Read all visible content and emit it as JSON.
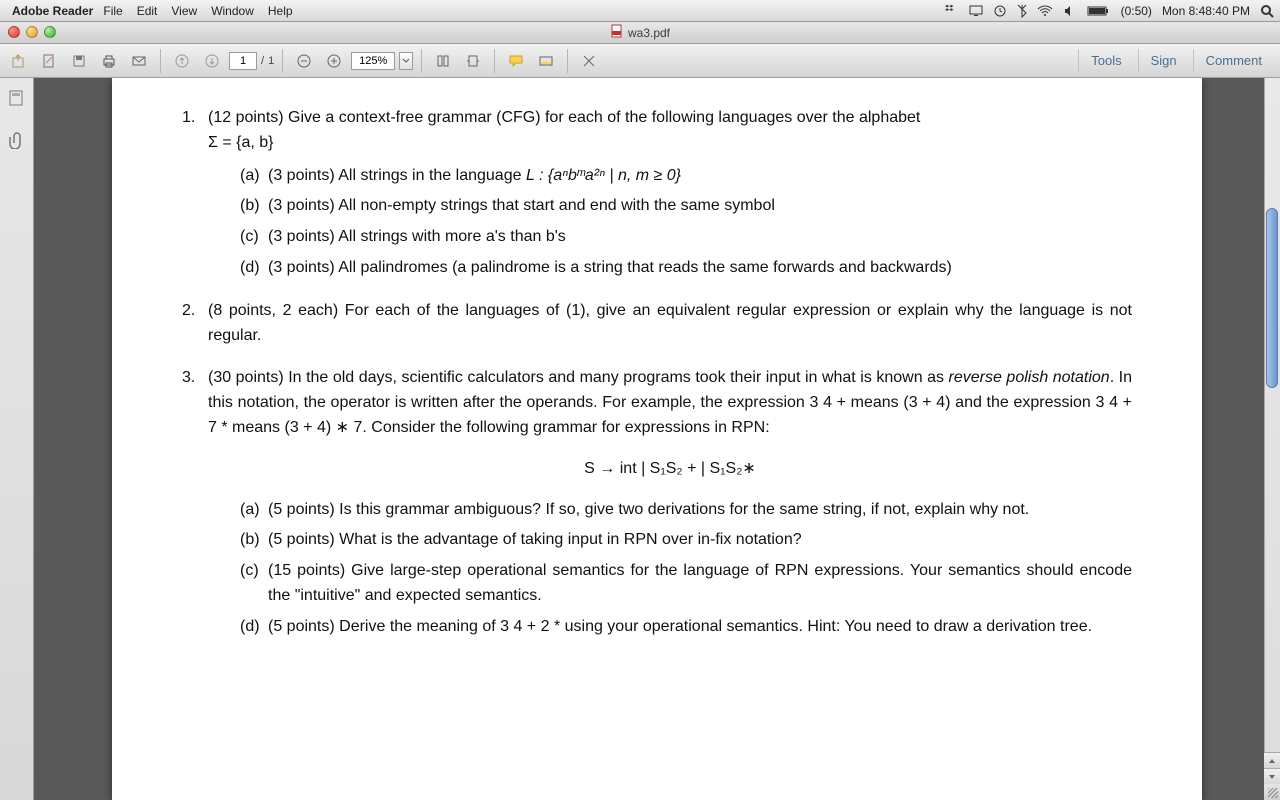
{
  "menu": {
    "app": "Adobe Reader",
    "items": [
      "File",
      "Edit",
      "View",
      "Window",
      "Help"
    ],
    "battery": "(0:50)",
    "clock": "Mon 8:48:40 PM"
  },
  "window": {
    "title": "wa3.pdf"
  },
  "toolbar": {
    "page_current": "1",
    "page_sep": "/",
    "page_total": "1",
    "zoom": "125%",
    "tabs": {
      "tools": "Tools",
      "sign": "Sign",
      "comment": "Comment"
    }
  },
  "doc": {
    "q1": {
      "num": "1.",
      "text_a": "(12 points) Give a context-free grammar (CFG) for each of the following languages over the alphabet",
      "sigma": "Σ = {a, b}",
      "a": {
        "lett": "(a)",
        "text_a": "(3 points) All strings in the language ",
        "L": "L : {aⁿbᵐa²ⁿ | n, m ≥ 0}"
      },
      "b": {
        "lett": "(b)",
        "text": "(3 points) All non-empty strings that start and end with the same symbol"
      },
      "c": {
        "lett": "(c)",
        "text": "(3 points) All strings with more a's than b's"
      },
      "d": {
        "lett": "(d)",
        "text": "(3 points) All palindromes (a palindrome is a string that reads the same forwards and backwards)"
      }
    },
    "q2": {
      "num": "2.",
      "text": "(8 points, 2 each) For each of the languages of (1), give an equivalent regular expression or explain why the language is not regular."
    },
    "q3": {
      "num": "3.",
      "text_a": "(30 points) In the old days, scientific calculators and many programs took their input in what is known as ",
      "rpn": "reverse polish notation",
      "text_b": ". In this notation, the operator is written after the operands. For example, the expression 3 4 + means (3 + 4) and the expression 3 4 + 7 * means (3 + 4) ∗ 7. Consider the following grammar for expressions in RPN:",
      "grammar": "S   →   int | S₁S₂ +  | S₁S₂∗",
      "a": {
        "lett": "(a)",
        "text": "(5 points) Is this grammar ambiguous? If so, give two derivations for the same string, if not, explain why not."
      },
      "b": {
        "lett": "(b)",
        "text": "(5 points) What is the advantage of taking input in RPN over in-fix notation?"
      },
      "c": {
        "lett": "(c)",
        "text": "(15 points) Give large-step operational semantics for the language of RPN expressions. Your semantics should encode the \"intuitive\" and expected semantics."
      },
      "d": {
        "lett": "(d)",
        "text": "(5 points) Derive the meaning of 3 4 + 2 * using your operational semantics. Hint: You need to draw a derivation tree."
      }
    }
  }
}
